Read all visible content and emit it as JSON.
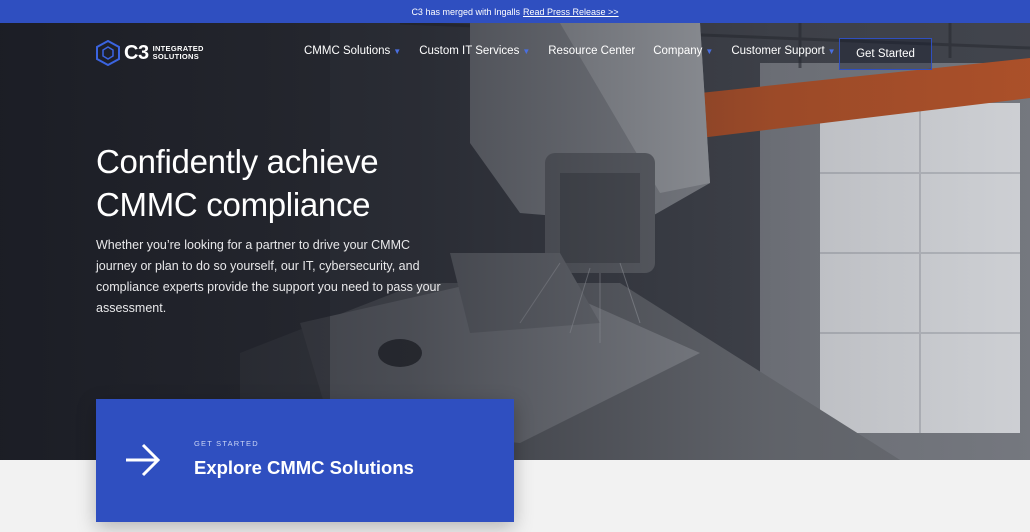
{
  "announcement": {
    "text": "C3 has merged with Ingalls",
    "link_label": "Read Press Release >>"
  },
  "brand": {
    "logo_mark": "C3",
    "logo_line1": "INTEGRATED",
    "logo_line2": "SOLUTIONS",
    "accent_color": "#2f4fc0"
  },
  "nav": {
    "items": [
      {
        "label": "CMMC Solutions",
        "has_dropdown": true
      },
      {
        "label": "Custom IT Services",
        "has_dropdown": true
      },
      {
        "label": "Resource Center",
        "has_dropdown": false
      },
      {
        "label": "Company",
        "has_dropdown": true
      },
      {
        "label": "Customer Support",
        "has_dropdown": true
      }
    ],
    "cta_label": "Get Started"
  },
  "hero": {
    "headline_line1": "Confidently achieve",
    "headline_line2": "CMMC compliance",
    "description": "Whether you’re looking for a partner to drive your CMMC journey or plan to do so yourself, our IT, cybersecurity, and compliance experts provide the support you need to pass your assessment."
  },
  "card": {
    "eyebrow": "GET STARTED",
    "title": "Explore CMMC Solutions",
    "icon": "arrow-right-icon"
  }
}
